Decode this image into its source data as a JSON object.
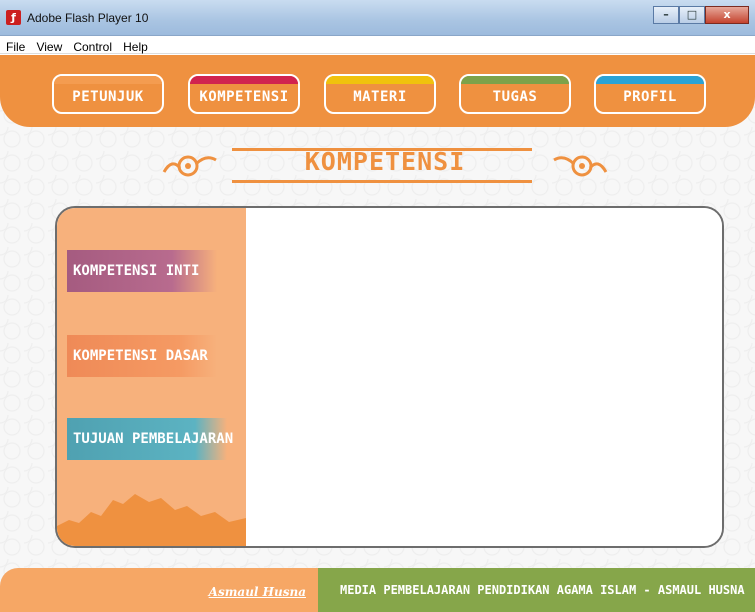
{
  "window": {
    "title": "Adobe Flash Player 10",
    "app_icon": "flash-icon",
    "minimize": "–",
    "maximize": "□",
    "close": "x"
  },
  "menu": [
    "File",
    "View",
    "Control",
    "Help"
  ],
  "nav": [
    {
      "label": "PETUNJUK",
      "accent": "#f49c50"
    },
    {
      "label": "KOMPETENSI",
      "accent": "#d1234f"
    },
    {
      "label": "MATERI",
      "accent": "#f0c20d"
    },
    {
      "label": "TUGAS",
      "accent": "#7da24a"
    },
    {
      "label": "PROFIL",
      "accent": "#2aa3d6"
    }
  ],
  "heading": "KOMPETENSI",
  "sidebar": [
    "KOMPETENSI INTI",
    "KOMPETENSI DASAR",
    "TUJUAN PEMBELAJARAN"
  ],
  "footer": {
    "logo": "Asmaul Husna",
    "tagline": "MEDIA PEMBELAJARAN PENDIDIKAN AGAMA ISLAM - ASMAUL HUSNA"
  },
  "colors": {
    "primary_orange": "#ef9140",
    "panel_side": "#f7b17c",
    "footer_green": "#86a64a"
  }
}
